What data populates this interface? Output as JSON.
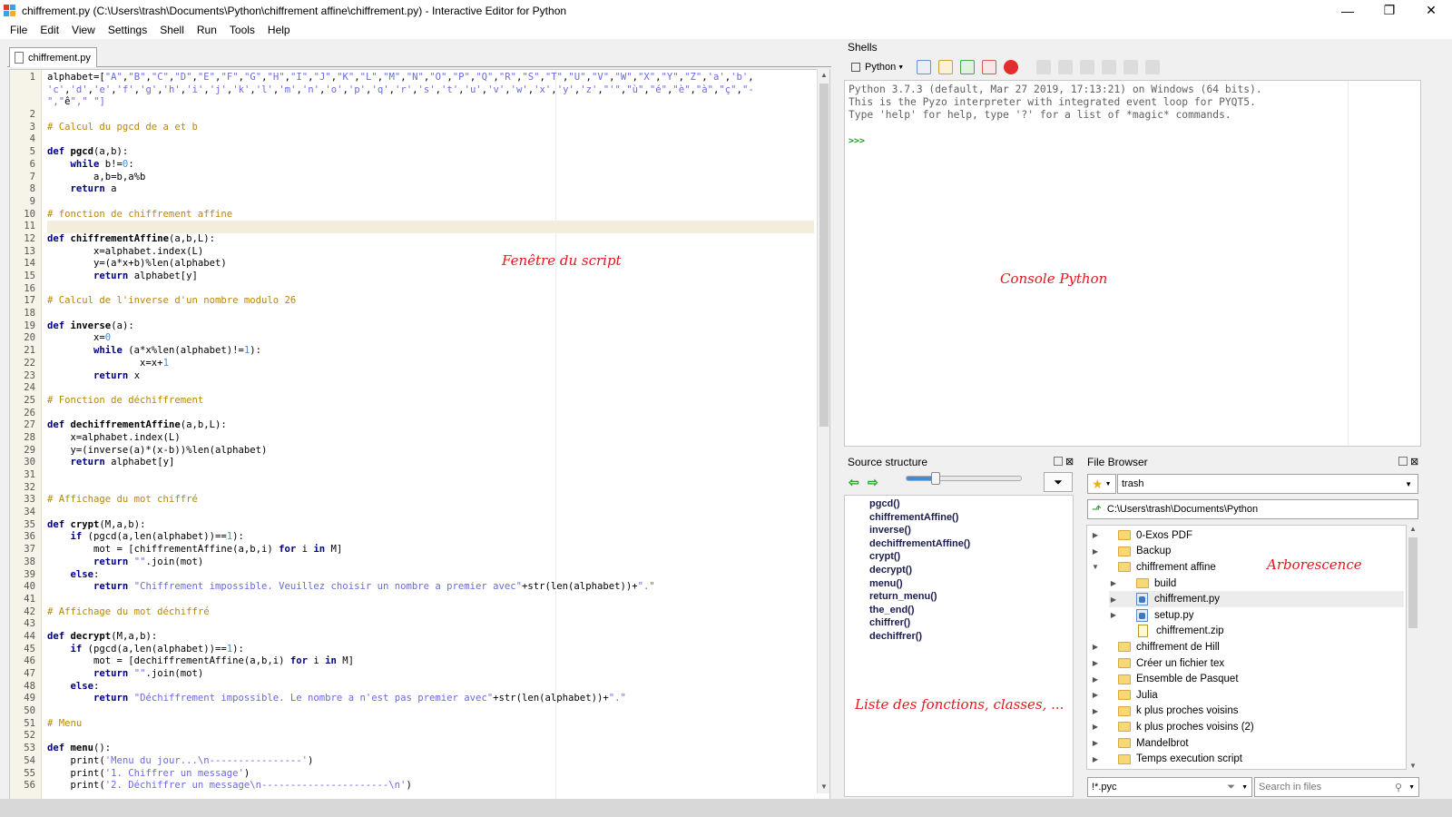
{
  "window": {
    "title": "chiffrement.py (C:\\Users\\trash\\Documents\\Python\\chiffrement affine\\chiffrement.py) - Interactive Editor for Python",
    "minimize": "—",
    "maximize": "❐",
    "close": "✕"
  },
  "menu": [
    "File",
    "Edit",
    "View",
    "Settings",
    "Shell",
    "Run",
    "Tools",
    "Help"
  ],
  "editor": {
    "tab_label": "chiffrement.py",
    "current_line": 11,
    "lines": [
      {
        "n": "1",
        "t": "alphabet=[\"A\",\"B\",\"C\",\"D\",\"E\",\"F\",\"G\",\"H\",\"I\",\"J\",\"K\",\"L\",\"M\",\"N\",\"O\",\"P\",\"Q\",\"R\",\"S\",\"T\",\"U\",\"V\",\"W\",\"X\",\"Y\",\"Z\",'a','b',"
      },
      {
        "n": "",
        "t": "'c','d','e','f','g','h','i','j','k','l','m','n','o','p','q','r','s','t','u','v','w','x','y','z',\"'\",\"ù\",\"é\",\"è\",\"à\",\"ç\",\"-"
      },
      {
        "n": "",
        "t": "\",\"ê\",\" \"]"
      },
      {
        "n": "2",
        "t": ""
      },
      {
        "n": "3",
        "t": "# Calcul du pgcd de a et b",
        "c": "cm"
      },
      {
        "n": "4",
        "t": ""
      },
      {
        "n": "5",
        "t": "def pgcd(a,b):",
        "c": "def"
      },
      {
        "n": "6",
        "t": "    while b!=0:"
      },
      {
        "n": "7",
        "t": "        a,b=b,a%b"
      },
      {
        "n": "8",
        "t": "    return a"
      },
      {
        "n": "9",
        "t": ""
      },
      {
        "n": "10",
        "t": "# fonction de chiffrement affine",
        "c": "cm"
      },
      {
        "n": "11",
        "t": ""
      },
      {
        "n": "12",
        "t": "def chiffrementAffine(a,b,L):",
        "c": "def"
      },
      {
        "n": "13",
        "t": "        x=alphabet.index(L)"
      },
      {
        "n": "14",
        "t": "        y=(a*x+b)%len(alphabet)"
      },
      {
        "n": "15",
        "t": "        return alphabet[y]"
      },
      {
        "n": "16",
        "t": ""
      },
      {
        "n": "17",
        "t": "# Calcul de l'inverse d'un nombre modulo 26",
        "c": "cm"
      },
      {
        "n": "18",
        "t": ""
      },
      {
        "n": "19",
        "t": "def inverse(a):",
        "c": "def"
      },
      {
        "n": "20",
        "t": "        x=0"
      },
      {
        "n": "21",
        "t": "        while (a*x%len(alphabet)!=1):"
      },
      {
        "n": "22",
        "t": "                x=x+1"
      },
      {
        "n": "23",
        "t": "        return x"
      },
      {
        "n": "24",
        "t": ""
      },
      {
        "n": "25",
        "t": "# Fonction de déchiffrement",
        "c": "cm"
      },
      {
        "n": "26",
        "t": ""
      },
      {
        "n": "27",
        "t": "def dechiffrementAffine(a,b,L):",
        "c": "def"
      },
      {
        "n": "28",
        "t": "    x=alphabet.index(L)"
      },
      {
        "n": "29",
        "t": "    y=(inverse(a)*(x-b))%len(alphabet)"
      },
      {
        "n": "30",
        "t": "    return alphabet[y]"
      },
      {
        "n": "31",
        "t": ""
      },
      {
        "n": "32",
        "t": ""
      },
      {
        "n": "33",
        "t": "# Affichage du mot chiffré",
        "c": "cm"
      },
      {
        "n": "34",
        "t": ""
      },
      {
        "n": "35",
        "t": "def crypt(M,a,b):",
        "c": "def"
      },
      {
        "n": "36",
        "t": "    if (pgcd(a,len(alphabet))==1):"
      },
      {
        "n": "37",
        "t": "        mot = [chiffrementAffine(a,b,i) for i in M]"
      },
      {
        "n": "38",
        "t": "        return \"\".join(mot)"
      },
      {
        "n": "39",
        "t": "    else:"
      },
      {
        "n": "40",
        "t": "        return \"Chiffrement impossible. Veuillez choisir un nombre a premier avec\"+str(len(alphabet))+\".\""
      },
      {
        "n": "41",
        "t": ""
      },
      {
        "n": "42",
        "t": "# Affichage du mot déchiffré",
        "c": "cm"
      },
      {
        "n": "43",
        "t": ""
      },
      {
        "n": "44",
        "t": "def decrypt(M,a,b):",
        "c": "def"
      },
      {
        "n": "45",
        "t": "    if (pgcd(a,len(alphabet))==1):"
      },
      {
        "n": "46",
        "t": "        mot = [dechiffrementAffine(a,b,i) for i in M]"
      },
      {
        "n": "47",
        "t": "        return \"\".join(mot)"
      },
      {
        "n": "48",
        "t": "    else:"
      },
      {
        "n": "49",
        "t": "        return \"Déchiffrement impossible. Le nombre a n'est pas premier avec\"+str(len(alphabet))+\".\""
      },
      {
        "n": "50",
        "t": ""
      },
      {
        "n": "51",
        "t": "# Menu",
        "c": "cm"
      },
      {
        "n": "52",
        "t": ""
      },
      {
        "n": "53",
        "t": "def menu():",
        "c": "def"
      },
      {
        "n": "54",
        "t": "    print('Menu du jour...\\n----------------')"
      },
      {
        "n": "55",
        "t": "    print('1. Chiffrer un message')"
      },
      {
        "n": "56",
        "t": "    print('2. Déchiffrer un message\\n----------------------\\n')"
      }
    ]
  },
  "annotations": {
    "script": "Fenêtre du script",
    "console": "Console Python",
    "functions": "Liste des fonctions, classes, ...",
    "tree": "Arborescence"
  },
  "shells": {
    "title": "Shells",
    "python_button": "Python",
    "banner": [
      "Python 3.7.3 (default, Mar 27 2019, 17:13:21) on Windows (64 bits).",
      "This is the Pyzo interpreter with integrated event loop for PYQT5.",
      "Type 'help' for help, type '?' for a list of *magic* commands."
    ],
    "prompt": ">>>"
  },
  "source_structure": {
    "title": "Source structure",
    "slider_level": 0.25,
    "items": [
      "pgcd()",
      "chiffrementAffine()",
      "inverse()",
      "dechiffrementAffine()",
      "crypt()",
      "decrypt()",
      "menu()",
      "return_menu()",
      "the_end()",
      "chiffrer()",
      "dechiffrer()"
    ]
  },
  "file_browser": {
    "title": "File Browser",
    "star_combo": "trash",
    "path": "C:\\Users\\trash\\Documents\\Python",
    "filter": "!*.pyc",
    "search_placeholder": "Search in files",
    "items": [
      {
        "label": "0-Exos PDF",
        "kind": "folder",
        "depth": 0,
        "arrow": "▶"
      },
      {
        "label": "Backup",
        "kind": "folder",
        "depth": 0,
        "arrow": "▶"
      },
      {
        "label": "chiffrement affine",
        "kind": "folder",
        "depth": 0,
        "arrow": "▼"
      },
      {
        "label": "build",
        "kind": "folder",
        "depth": 1,
        "arrow": "▶"
      },
      {
        "label": "chiffrement.py",
        "kind": "py",
        "depth": 1,
        "arrow": "▶"
      },
      {
        "label": "setup.py",
        "kind": "py",
        "depth": 1,
        "arrow": "▶"
      },
      {
        "label": "chiffrement.zip",
        "kind": "zip",
        "depth": 1,
        "arrow": ""
      },
      {
        "label": "chiffrement de Hill",
        "kind": "folder",
        "depth": 0,
        "arrow": "▶"
      },
      {
        "label": "Créer un fichier tex",
        "kind": "folder",
        "depth": 0,
        "arrow": "▶"
      },
      {
        "label": "Ensemble de Pasquet",
        "kind": "folder",
        "depth": 0,
        "arrow": "▶"
      },
      {
        "label": "Julia",
        "kind": "folder",
        "depth": 0,
        "arrow": "▶"
      },
      {
        "label": "k plus proches voisins",
        "kind": "folder",
        "depth": 0,
        "arrow": "▶"
      },
      {
        "label": "k plus proches voisins (2)",
        "kind": "folder",
        "depth": 0,
        "arrow": "▶"
      },
      {
        "label": "Mandelbrot",
        "kind": "folder",
        "depth": 0,
        "arrow": "▶"
      },
      {
        "label": "Temps execution script",
        "kind": "folder",
        "depth": 0,
        "arrow": "▶"
      }
    ]
  },
  "colors": {
    "comment": "#b8860b",
    "keyword": "#000080",
    "number": "#4a8cd2",
    "string": "#6a6adc",
    "annotation": "#e8141c"
  }
}
